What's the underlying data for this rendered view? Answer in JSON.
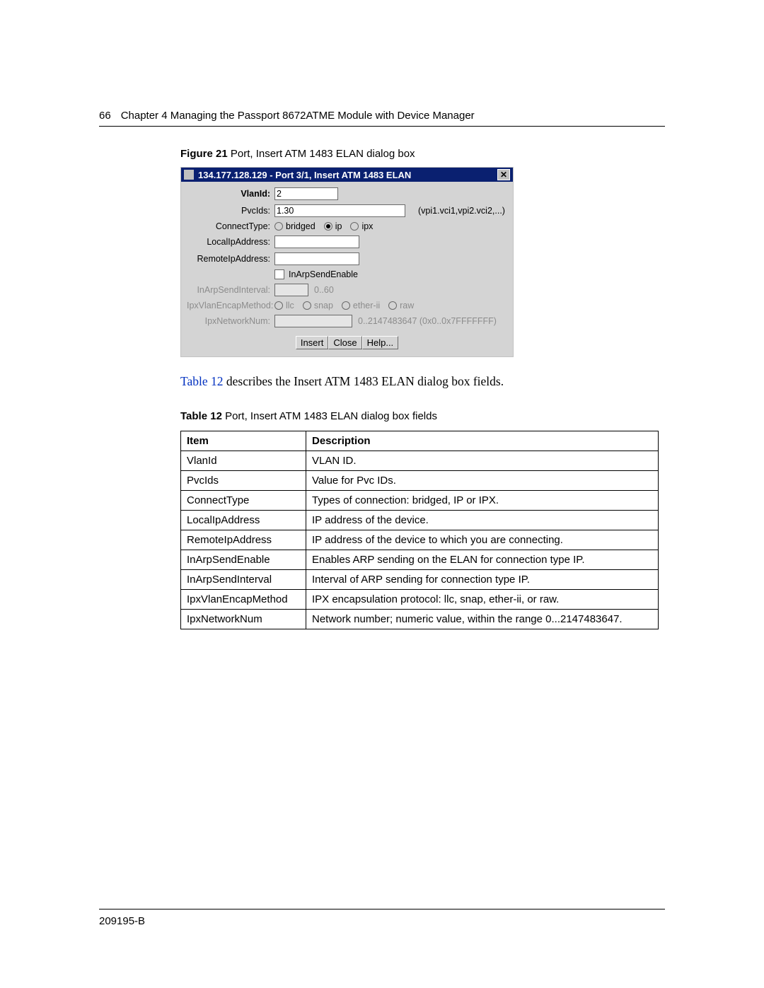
{
  "header": {
    "page_number": "66",
    "chapter_line": "Chapter 4  Managing the Passport 8672ATME Module with Device Manager"
  },
  "figure": {
    "label_bold": "Figure 21",
    "label_rest": "   Port, Insert ATM 1483 ELAN dialog box"
  },
  "dialog": {
    "title": "134.177.128.129 - Port 3/1, Insert ATM 1483 ELAN",
    "close_icon": "✕",
    "rows": {
      "vlanid": {
        "label": "VlanId:",
        "value": "2"
      },
      "pvcids": {
        "label": "PvcIds:",
        "value": "1.30",
        "hint": "(vpi1.vci1,vpi2.vci2,...)"
      },
      "connect": {
        "label": "ConnectType:",
        "options": [
          {
            "text": "bridged",
            "selected": false
          },
          {
            "text": "ip",
            "selected": true
          },
          {
            "text": "ipx",
            "selected": false
          }
        ]
      },
      "localip": {
        "label": "LocalIpAddress:",
        "value": ""
      },
      "remoteip": {
        "label": "RemoteIpAddress:",
        "value": ""
      },
      "inarpen": {
        "label": "",
        "checkbox_label": "InArpSendEnable"
      },
      "inarpint": {
        "label": "InArpSendInterval:",
        "value": "",
        "hint": "0..60"
      },
      "ipxenc": {
        "label": "IpxVlanEncapMethod:",
        "options": [
          {
            "text": "llc",
            "selected": false
          },
          {
            "text": "snap",
            "selected": false
          },
          {
            "text": "ether-ii",
            "selected": false
          },
          {
            "text": "raw",
            "selected": false
          }
        ]
      },
      "ipxnet": {
        "label": "IpxNetworkNum:",
        "value": "",
        "hint": "0..2147483647 (0x0..0x7FFFFFFF)"
      }
    },
    "buttons": {
      "insert": "Insert",
      "close": "Close",
      "help": "Help..."
    }
  },
  "paragraph": {
    "link": "Table 12",
    "rest": " describes the Insert ATM 1483 ELAN dialog box fields."
  },
  "table_caption": {
    "label_bold": "Table 12",
    "label_rest": "   Port, Insert ATM 1483 ELAN dialog box fields"
  },
  "fields_table": {
    "headers": {
      "col1": "Item",
      "col2": "Description"
    },
    "rows": [
      {
        "item": "VlanId",
        "desc": "VLAN ID."
      },
      {
        "item": "PvcIds",
        "desc": "Value for Pvc IDs."
      },
      {
        "item": "ConnectType",
        "desc": "Types of connection: bridged, IP or IPX."
      },
      {
        "item": "LocalIpAddress",
        "desc": "IP address of the device."
      },
      {
        "item": "RemoteIpAddress",
        "desc": "IP address of the device to which you are connecting."
      },
      {
        "item": "InArpSendEnable",
        "desc": "Enables ARP sending on the ELAN for connection type IP."
      },
      {
        "item": "InArpSendInterval",
        "desc": "Interval of ARP sending for connection type IP."
      },
      {
        "item": "IpxVlanEncapMethod",
        "desc": "IPX encapsulation protocol: llc, snap, ether-ii, or raw."
      },
      {
        "item": "IpxNetworkNum",
        "desc": "Network number; numeric value, within the range 0...2147483647."
      }
    ]
  },
  "footer": {
    "doc_id": "209195-B"
  }
}
